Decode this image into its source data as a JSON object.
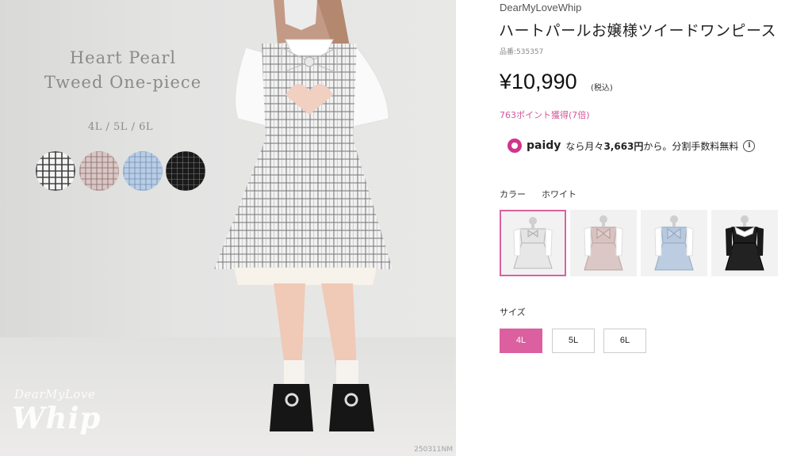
{
  "hero": {
    "title_line1": "Heart Pearl",
    "title_line2": "Tweed One-piece",
    "sizes_caption": "4L / 5L / 6L",
    "swatches": [
      "white-tweed",
      "pink-tweed",
      "blue-tweed",
      "black-tweed"
    ],
    "logo_small": "DearMyLove",
    "logo_big": "Whip",
    "photo_code": "250311NM"
  },
  "product": {
    "brand": "DearMyLoveWhip",
    "name": "ハートパールお嬢様ツイードワンピース",
    "sku": "品番:535357",
    "price": "¥10,990",
    "tax_note": "(税込)",
    "points": "763ポイント獲得(7倍)",
    "paidy": {
      "logo": "paidy",
      "text_prefix": "なら月々",
      "amount": "3,663円",
      "text_suffix": "から。分割手数料無料",
      "info_icon": "i"
    }
  },
  "color_selector": {
    "label": "カラー",
    "selected": "ホワイト",
    "options": [
      "white",
      "pink",
      "blue",
      "black"
    ]
  },
  "size_selector": {
    "label": "サイズ",
    "options": [
      "4L",
      "5L",
      "6L"
    ],
    "selected": "4L"
  },
  "colors": {
    "accent_pink": "#dc5f9f",
    "points_pink": "#d2569a",
    "paidy_magenta": "#d0348b"
  }
}
